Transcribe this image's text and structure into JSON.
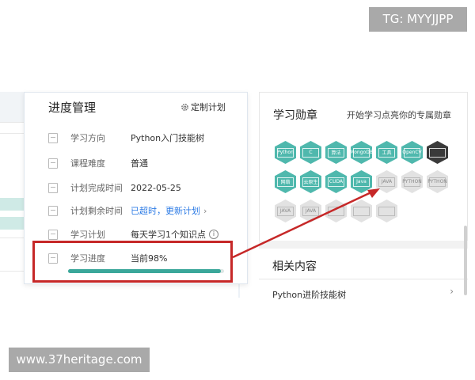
{
  "overlay": {
    "tg_label": "TG: MYYJJPP",
    "watermark": "www.37heritage.com"
  },
  "progress_popup": {
    "title": "进度管理",
    "custom_plan_label": "定制计划",
    "rows": [
      {
        "label": "学习方向",
        "value": "Python入门技能树"
      },
      {
        "label": "课程难度",
        "value": "普通"
      },
      {
        "label": "计划完成时间",
        "value": "2022-05-25"
      },
      {
        "label": "计划剩余时间",
        "value": "已超时，更新计划"
      },
      {
        "label": "学习计划",
        "value": "每天学习1个知识点"
      },
      {
        "label": "学习进度",
        "value": "当前98%"
      }
    ],
    "progress_percent": 98,
    "progress_color": "#3aa79a"
  },
  "badges_panel": {
    "title": "学习勋章",
    "subtitle": "开始学习点亮你的专属勋章",
    "badges": [
      {
        "label": "Python",
        "state": "lit"
      },
      {
        "label": "C",
        "state": "lit"
      },
      {
        "label": "算法",
        "state": "lit"
      },
      {
        "label": "MongoDB",
        "state": "lit"
      },
      {
        "label": "工具",
        "state": "lit"
      },
      {
        "label": "OpenCV",
        "state": "lit"
      },
      {
        "label": "",
        "state": "dark"
      },
      {
        "label": "网络",
        "state": "lit"
      },
      {
        "label": "云原生",
        "state": "lit"
      },
      {
        "label": "CUDA",
        "state": "lit"
      },
      {
        "label": "Java",
        "state": "lit"
      },
      {
        "label": "JAVA",
        "state": "unlit"
      },
      {
        "label": "PYTHON",
        "state": "unlit"
      },
      {
        "label": "PYTHON",
        "state": "unlit"
      },
      {
        "label": "JAVA",
        "state": "unlit"
      },
      {
        "label": "JAVA",
        "state": "unlit"
      },
      {
        "label": "",
        "state": "unlit"
      },
      {
        "label": "",
        "state": "unlit"
      },
      {
        "label": "",
        "state": "unlit"
      }
    ]
  },
  "related_panel": {
    "title": "相关内容",
    "item": "Python进阶技能树"
  }
}
